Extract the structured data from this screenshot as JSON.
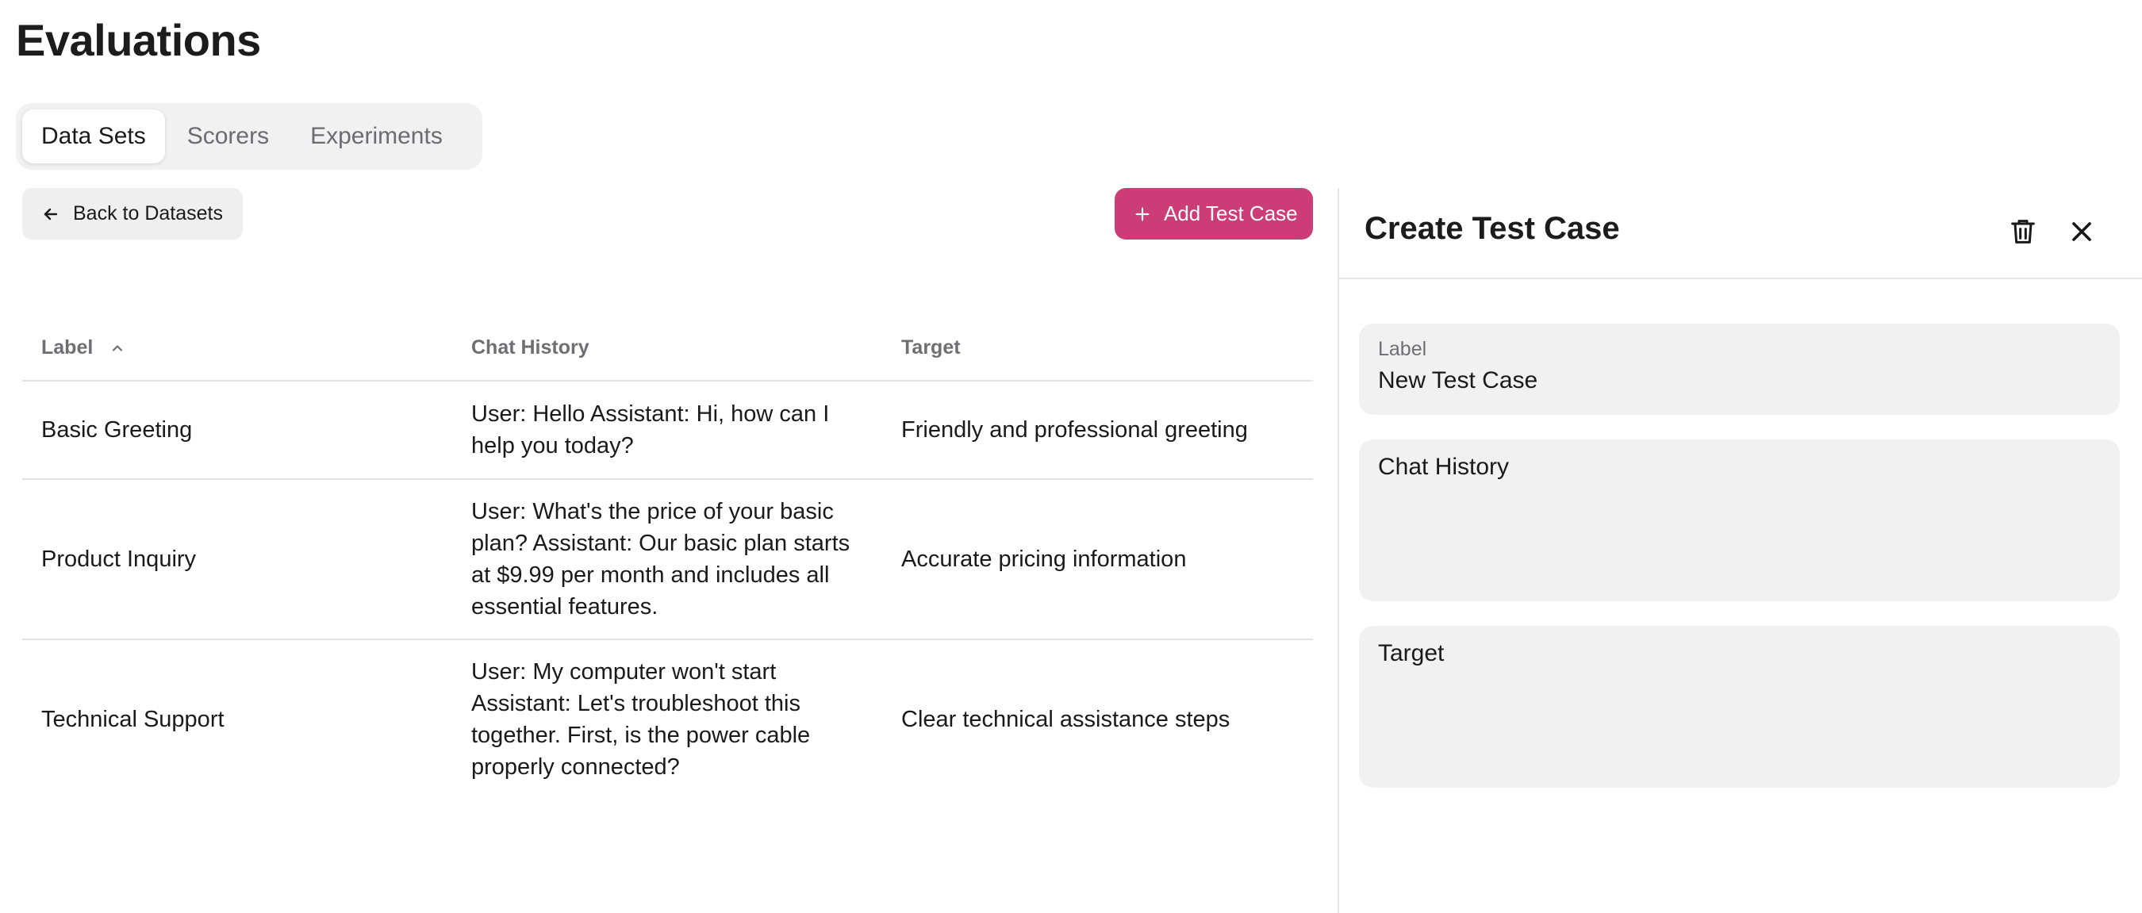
{
  "page": {
    "title": "Evaluations"
  },
  "tabs": [
    {
      "label": "Data Sets",
      "active": true
    },
    {
      "label": "Scorers",
      "active": false
    },
    {
      "label": "Experiments",
      "active": false
    }
  ],
  "toolbar": {
    "back_label": "Back to Datasets",
    "back_icon": "arrow-left-icon",
    "add_label": "Add Test Case",
    "add_icon": "plus-icon",
    "add_color": "#cc3d78"
  },
  "table": {
    "columns": [
      "Label",
      "Chat History",
      "Target"
    ],
    "sort": {
      "column": "Label",
      "direction": "ascending"
    },
    "rows": [
      {
        "label": "Basic Greeting",
        "chat_history": "User: Hello Assistant: Hi, how can I help you today?",
        "target": "Friendly and professional greeting"
      },
      {
        "label": "Product Inquiry",
        "chat_history": "User: What's the price of your basic plan? Assistant: Our basic plan starts at $9.99 per month and includes all essential features.",
        "target": "Accurate pricing information"
      },
      {
        "label": "Technical Support",
        "chat_history": "User: My computer won't start Assistant: Let's troubleshoot this together. First, is the power cable properly connected?",
        "target": "Clear technical assistance steps"
      }
    ]
  },
  "panel": {
    "title": "Create Test Case",
    "delete_icon": "trash-icon",
    "close_icon": "close-icon",
    "fields": {
      "label": {
        "label": "Label",
        "value": "New Test Case"
      },
      "chat_history": {
        "placeholder": "Chat History",
        "value": ""
      },
      "target": {
        "placeholder": "Target",
        "value": ""
      }
    }
  }
}
